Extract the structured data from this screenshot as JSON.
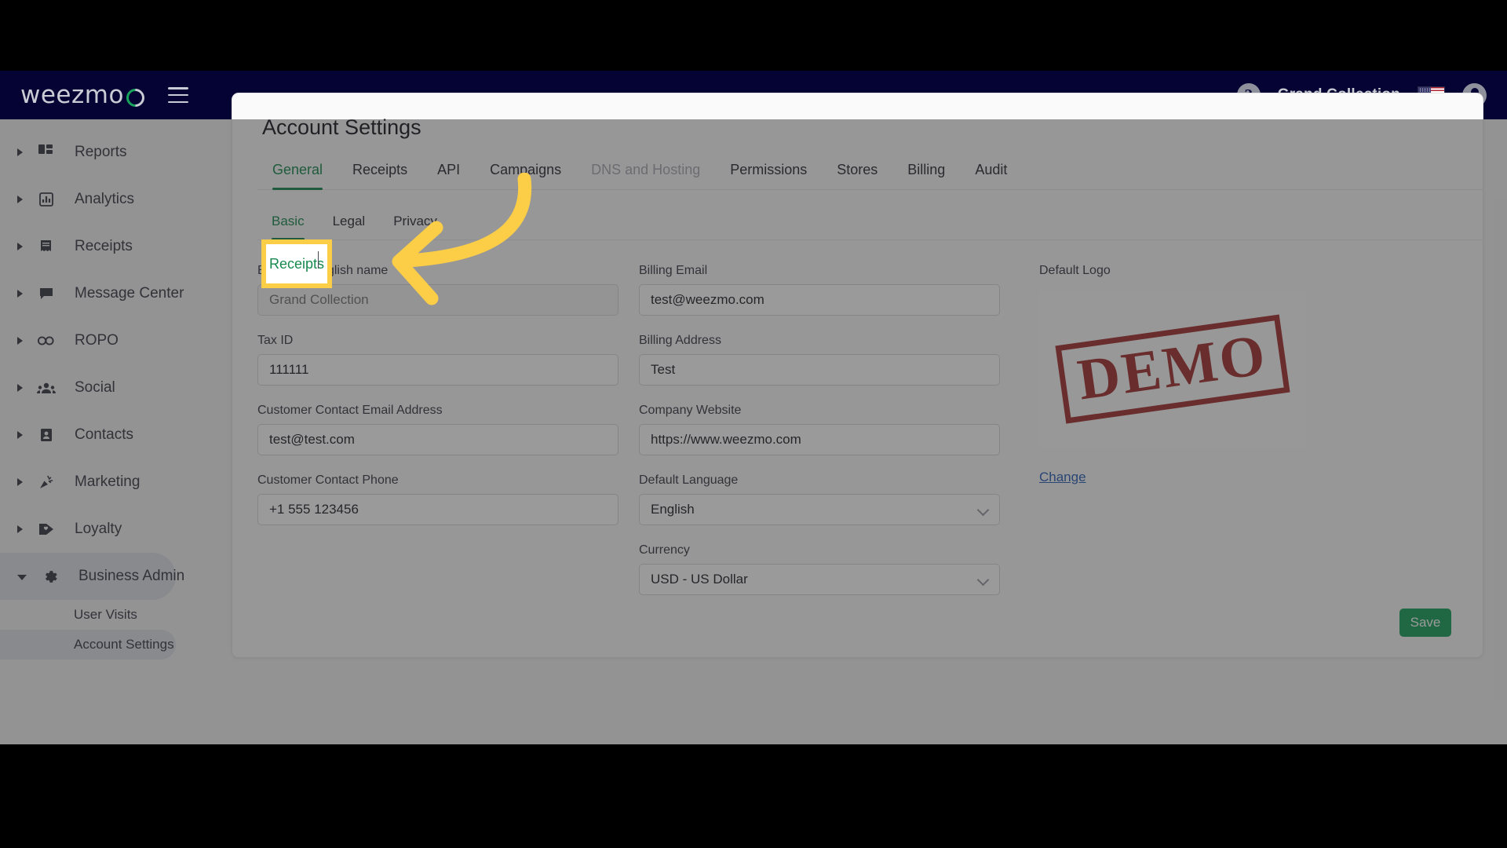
{
  "brand": {
    "logo_text": "weezmo",
    "accent_green": "#17a35b",
    "topbar_color": "#050334"
  },
  "topbar": {
    "help_icon": "help-icon",
    "account_name": "Grand Collection",
    "flag": "us-flag-icon",
    "avatar": "account-avatar-icon",
    "menu_toggle": "hamburger-icon"
  },
  "sidebar": {
    "items": [
      {
        "label": "Reports",
        "icon": "dashboard-grid-icon",
        "expanded": false
      },
      {
        "label": "Analytics",
        "icon": "bar-chart-icon",
        "expanded": false
      },
      {
        "label": "Receipts",
        "icon": "receipt-icon",
        "expanded": false
      },
      {
        "label": "Message Center",
        "icon": "chat-bubble-icon",
        "expanded": false
      },
      {
        "label": "ROPO",
        "icon": "infinity-icon",
        "expanded": false
      },
      {
        "label": "Social",
        "icon": "people-group-icon",
        "expanded": false
      },
      {
        "label": "Contacts",
        "icon": "contact-card-icon",
        "expanded": false
      },
      {
        "label": "Marketing",
        "icon": "party-popper-icon",
        "expanded": false
      },
      {
        "label": "Loyalty",
        "icon": "tag-heart-icon",
        "expanded": false
      },
      {
        "label": "Business Admin",
        "icon": "gear-icon",
        "expanded": true
      }
    ],
    "sub_items": [
      {
        "label": "User Visits",
        "active": false
      },
      {
        "label": "Account Settings",
        "active": true
      }
    ]
  },
  "main": {
    "title": "Account Settings",
    "tabs": [
      {
        "label": "General",
        "state": "active"
      },
      {
        "label": "Receipts",
        "state": "highlighted"
      },
      {
        "label": "API",
        "state": "normal"
      },
      {
        "label": "Campaigns",
        "state": "normal"
      },
      {
        "label": "DNS and Hosting",
        "state": "disabled"
      },
      {
        "label": "Permissions",
        "state": "normal"
      },
      {
        "label": "Stores",
        "state": "normal"
      },
      {
        "label": "Billing",
        "state": "normal"
      },
      {
        "label": "Audit",
        "state": "normal"
      }
    ],
    "subtabs": [
      {
        "label": "Basic",
        "active": true
      },
      {
        "label": "Legal",
        "active": false
      },
      {
        "label": "Privacy",
        "active": false
      }
    ],
    "fields_left": [
      {
        "label": "Business English name",
        "value": "",
        "placeholder": "Grand Collection",
        "type": "text",
        "disabled": true
      },
      {
        "label": "Tax ID",
        "value": "111111",
        "placeholder": "",
        "type": "text",
        "disabled": false
      },
      {
        "label": "Customer Contact Email Address",
        "value": "test@test.com",
        "placeholder": "",
        "type": "text",
        "disabled": false
      },
      {
        "label": "Customer Contact Phone",
        "value": "+1 555 123456",
        "placeholder": "",
        "type": "text",
        "disabled": false
      }
    ],
    "fields_middle": [
      {
        "label": "Billing Email",
        "value": "test@weezmo.com",
        "placeholder": "",
        "type": "text",
        "disabled": false
      },
      {
        "label": "Billing Address",
        "value": "Test",
        "placeholder": "",
        "type": "text",
        "disabled": false
      },
      {
        "label": "Company Website",
        "value": "https://www.weezmo.com",
        "placeholder": "",
        "type": "text",
        "disabled": false
      },
      {
        "label": "Default Language",
        "value": "English",
        "placeholder": "",
        "type": "select",
        "disabled": false
      },
      {
        "label": "Currency",
        "value": "USD - US Dollar",
        "placeholder": "",
        "type": "select",
        "disabled": false
      }
    ],
    "logo": {
      "label": "Default Logo",
      "stamp_text": "DEMO",
      "stamp_color": "#9c2222",
      "change_link": "Change"
    },
    "save_label": "Save"
  },
  "annotation": {
    "highlight_tab": "Receipts",
    "highlight_border_color": "#fccd47",
    "arrow": "curved-left-arrow"
  }
}
